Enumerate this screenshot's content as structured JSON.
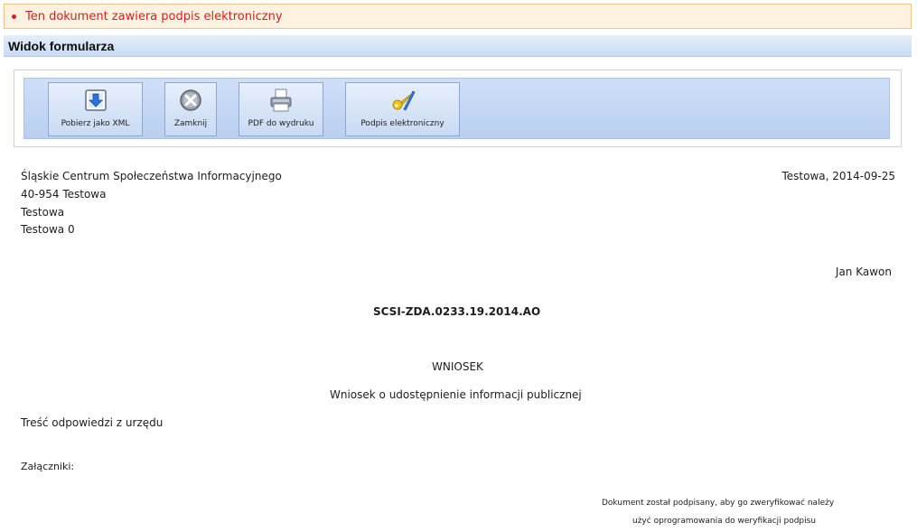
{
  "alert": {
    "text": "Ten dokument zawiera podpis elektroniczny"
  },
  "panel": {
    "title": "Widok formularza"
  },
  "toolbar": {
    "buttons": [
      {
        "label": "Pobierz jako XML",
        "icon": "download-icon"
      },
      {
        "label": "Zamknij",
        "icon": "close-icon"
      },
      {
        "label": "PDF do wydruku",
        "icon": "printer-icon"
      },
      {
        "label": "Podpis elektroniczny",
        "icon": "key-pen-icon"
      }
    ]
  },
  "document": {
    "sender": {
      "name": "Śląskie Centrum Społeczeństwa Informacyjnego",
      "postal": "40-954 Testowa",
      "city": "Testowa",
      "street": "Testowa 0"
    },
    "place_date": "Testowa, 2014-09-25",
    "recipient": "Jan Kawon",
    "case_number": "SCSI-ZDA.0233.19.2014.AO",
    "type": "WNIOSEK",
    "subtitle": "Wniosek o udostępnienie informacji publicznej",
    "body": "Treść odpowiedzi z urzędu",
    "attachments_label": "Załączniki:",
    "signature_note_1": "Dokument został podpisany, aby go zweryfikować należy",
    "signature_note_2": "użyć oprogramowania do weryfikacji podpisu"
  }
}
